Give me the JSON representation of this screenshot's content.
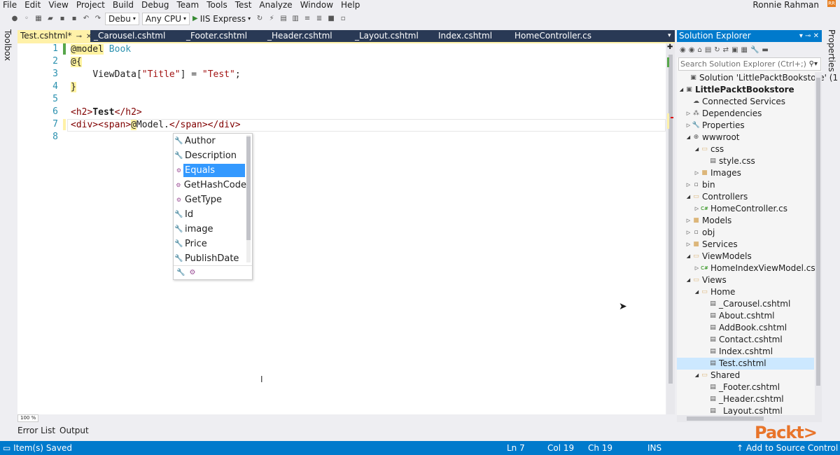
{
  "menu": [
    "File",
    "Edit",
    "View",
    "Project",
    "Build",
    "Debug",
    "Team",
    "Tools",
    "Test",
    "Analyze",
    "Window",
    "Help"
  ],
  "user": {
    "name": "Ronnie Rahman",
    "badge": "RR"
  },
  "toolbar": {
    "config": "Debu",
    "platform": "Any CPU",
    "run_target": "IIS Express"
  },
  "side_strips": {
    "left": "Toolbox",
    "right": "Properties"
  },
  "tabs": [
    {
      "label": "Test.cshtml*",
      "active": true
    },
    {
      "label": "_Carousel.cshtml"
    },
    {
      "label": "_Footer.cshtml"
    },
    {
      "label": "_Header.cshtml"
    },
    {
      "label": "_Layout.cshtml"
    },
    {
      "label": "Index.cshtml"
    },
    {
      "label": "HomeController.cs"
    }
  ],
  "editor": {
    "line_numbers": [
      "1",
      "2",
      "3",
      "4",
      "5",
      "6",
      "7",
      "8"
    ],
    "line1": {
      "directive": "@model",
      "type": "Book"
    },
    "line2": {
      "open": "@{"
    },
    "line3": {
      "name": "ViewData",
      "lb": "[",
      "key": "\"Title\"",
      "rb": "] = ",
      "val": "\"Test\"",
      "end": ";"
    },
    "line4": {
      "close": "}"
    },
    "line6": {
      "open": "<h2>",
      "text": "Test",
      "close": "</h2>"
    },
    "line7": {
      "a": "<div><span>",
      "at": "@",
      "model": "Model.",
      "b": "</span></div>"
    },
    "zoom": "100 %"
  },
  "intellisense": {
    "items": [
      {
        "label": "Author",
        "kind": "property"
      },
      {
        "label": "Description",
        "kind": "property"
      },
      {
        "label": "Equals",
        "kind": "method",
        "selected": true
      },
      {
        "label": "GetHashCode",
        "kind": "method"
      },
      {
        "label": "GetType",
        "kind": "method"
      },
      {
        "label": "Id",
        "kind": "property"
      },
      {
        "label": "image",
        "kind": "property"
      },
      {
        "label": "Price",
        "kind": "property"
      },
      {
        "label": "PublishDate",
        "kind": "property"
      }
    ]
  },
  "solution_explorer": {
    "title": "Solution Explorer",
    "search_placeholder": "Search Solution Explorer (Ctrl+;)",
    "nodes": [
      {
        "label": "Solution 'LittlePacktBookstore' (1",
        "depth": 0,
        "icon": "solution",
        "arrow": ""
      },
      {
        "label": "LittlePacktBookstore",
        "depth": 0,
        "icon": "project",
        "arrow": "down",
        "bold": true
      },
      {
        "label": "Connected Services",
        "depth": 1,
        "icon": "connected",
        "arrow": ""
      },
      {
        "label": "Dependencies",
        "depth": 1,
        "icon": "deps",
        "arrow": "right"
      },
      {
        "label": "Properties",
        "depth": 1,
        "icon": "wrench",
        "arrow": "right"
      },
      {
        "label": "wwwroot",
        "depth": 1,
        "icon": "globe",
        "arrow": "down"
      },
      {
        "label": "css",
        "depth": 2,
        "icon": "folder-open",
        "arrow": "down"
      },
      {
        "label": "style.css",
        "depth": 3,
        "icon": "file",
        "arrow": ""
      },
      {
        "label": "Images",
        "depth": 2,
        "icon": "folder",
        "arrow": "right"
      },
      {
        "label": "bin",
        "depth": 1,
        "icon": "folder-hidden",
        "arrow": "right"
      },
      {
        "label": "Controllers",
        "depth": 1,
        "icon": "folder-open",
        "arrow": "down"
      },
      {
        "label": "HomeController.cs",
        "depth": 2,
        "icon": "cs",
        "arrow": "right"
      },
      {
        "label": "Models",
        "depth": 1,
        "icon": "folder",
        "arrow": "right"
      },
      {
        "label": "obj",
        "depth": 1,
        "icon": "folder-hidden",
        "arrow": "right"
      },
      {
        "label": "Services",
        "depth": 1,
        "icon": "folder",
        "arrow": "right"
      },
      {
        "label": "ViewModels",
        "depth": 1,
        "icon": "folder-open",
        "arrow": "down"
      },
      {
        "label": "HomeIndexViewModel.cs",
        "depth": 2,
        "icon": "cs",
        "arrow": "right"
      },
      {
        "label": "Views",
        "depth": 1,
        "icon": "folder-open",
        "arrow": "down"
      },
      {
        "label": "Home",
        "depth": 2,
        "icon": "folder-open",
        "arrow": "down"
      },
      {
        "label": "_Carousel.cshtml",
        "depth": 3,
        "icon": "file",
        "arrow": ""
      },
      {
        "label": "About.cshtml",
        "depth": 3,
        "icon": "file",
        "arrow": ""
      },
      {
        "label": "AddBook.cshtml",
        "depth": 3,
        "icon": "file",
        "arrow": ""
      },
      {
        "label": "Contact.cshtml",
        "depth": 3,
        "icon": "file",
        "arrow": ""
      },
      {
        "label": "Index.cshtml",
        "depth": 3,
        "icon": "file",
        "arrow": ""
      },
      {
        "label": "Test.cshtml",
        "depth": 3,
        "icon": "file",
        "arrow": "",
        "selected": true
      },
      {
        "label": "Shared",
        "depth": 2,
        "icon": "folder-open",
        "arrow": "down"
      },
      {
        "label": "_Footer.cshtml",
        "depth": 3,
        "icon": "file",
        "arrow": ""
      },
      {
        "label": "_Header.cshtml",
        "depth": 3,
        "icon": "file",
        "arrow": ""
      },
      {
        "label": "_Layout.cshtml",
        "depth": 3,
        "icon": "file",
        "arrow": ""
      }
    ]
  },
  "bottom_tabs": [
    "Error List",
    "Output"
  ],
  "status": {
    "message": "Item(s) Saved",
    "ln": "Ln 7",
    "col": "Col 19",
    "ch": "Ch 19",
    "ins": "INS",
    "source_control": "Add to Source Control"
  },
  "watermark": "Packt>",
  "colors": {
    "accent": "#007acc",
    "tab_active": "#fff1a8",
    "selection": "#3399ff"
  }
}
